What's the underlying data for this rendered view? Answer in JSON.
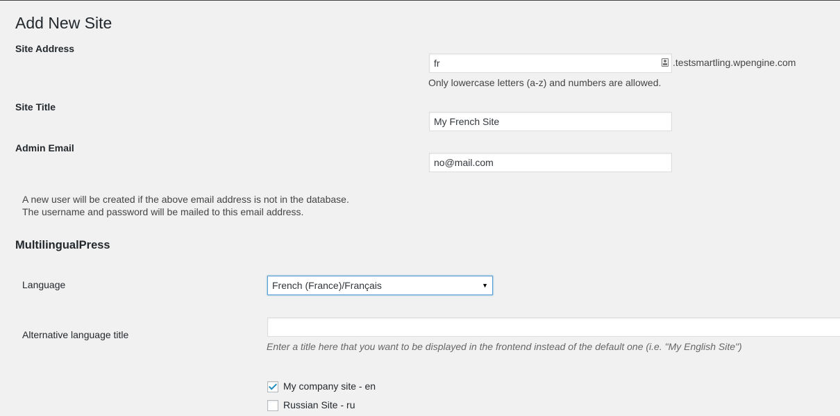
{
  "page": {
    "title": "Add New Site"
  },
  "site_address": {
    "label": "Site Address",
    "value": "fr",
    "suffix": ".testsmartling.wpengine.com",
    "description": "Only lowercase letters (a-z) and numbers are allowed.",
    "autofill_icon": "contact-card-icon"
  },
  "site_title": {
    "label": "Site Title",
    "value": "My French Site"
  },
  "admin_email": {
    "label": "Admin Email",
    "value": "no@mail.com"
  },
  "email_note": {
    "line1": "A new user will be created if the above email address is not in the database.",
    "line2": "The username and password will be mailed to this email address."
  },
  "multilingual": {
    "section_title": "MultilingualPress",
    "language_label": "Language",
    "language_selected": "French (France)/Français",
    "alt_title_label": "Alternative language title",
    "alt_title_value": "",
    "alt_title_hint": "Enter a title here that you want to be displayed in the frontend instead of the default one (i.e. \"My English Site\")",
    "related_sites": [
      {
        "label": "My company site - en",
        "checked": true
      },
      {
        "label": "Russian Site - ru",
        "checked": false
      }
    ]
  },
  "colors": {
    "background": "#f1f1f1",
    "focus_border": "#5b9dd9",
    "checkmark": "#1e8cbe"
  }
}
